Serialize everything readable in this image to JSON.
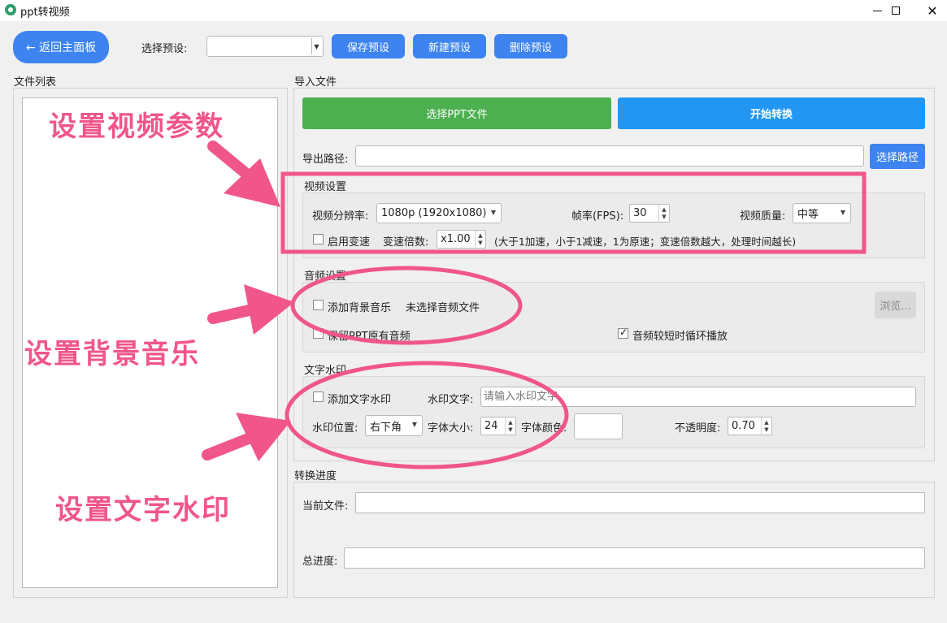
{
  "window": {
    "title": "ppt转视频"
  },
  "toolbar": {
    "back_label": "← 返回主面板",
    "preset_label": "选择预设:",
    "preset_value": "",
    "save_label": "保存预设",
    "new_label": "新建预设",
    "delete_label": "删除预设"
  },
  "file_list": {
    "title": "文件列表"
  },
  "import": {
    "title": "导入文件",
    "select_ppt_label": "选择PPT文件",
    "start_label": "开始转换",
    "export_path_label": "导出路径:",
    "export_path_value": "",
    "choose_path_label": "选择路径"
  },
  "video_settings": {
    "title": "视频设置",
    "resolution_label": "视频分辨率:",
    "resolution_value": "1080p (1920x1080)",
    "fps_label": "帧率(FPS):",
    "fps_value": "30",
    "quality_label": "视频质量:",
    "quality_value": "中等",
    "speed_enable_label": "启用变速",
    "speed_enabled": false,
    "speed_ratio_label": "变速倍数:",
    "speed_ratio_value": "x1.00",
    "speed_hint": "(大于1加速，小于1减速，1为原速；变速倍数越大，处理时间越长)"
  },
  "audio_settings": {
    "title": "音频设置",
    "add_bgm_label": "添加背景音乐",
    "add_bgm_checked": false,
    "no_audio_text": "未选择音频文件",
    "browse_label": "浏览...",
    "keep_original_label": "保留PPT原有音频",
    "keep_original_checked": false,
    "loop_label": "音频较短时循环播放",
    "loop_checked": true
  },
  "watermark": {
    "title": "文字水印",
    "add_label": "添加文字水印",
    "add_checked": false,
    "text_label": "水印文字:",
    "text_placeholder": "请输入水印文字",
    "position_label": "水印位置:",
    "position_value": "右下角",
    "font_size_label": "字体大小:",
    "font_size_value": "24",
    "font_color_label": "字体颜色:",
    "opacity_label": "不透明度:",
    "opacity_value": "0.70"
  },
  "progress": {
    "title": "转换进度",
    "current_file_label": "当前文件:",
    "total_label": "总进度:"
  },
  "annotations": {
    "video_params": "设置视频参数",
    "bgm": "设置背景音乐",
    "watermark": "设置文字水印",
    "color": "#f0568a"
  },
  "colors": {
    "accent_blue": "#3d84f0",
    "green": "#4caf50",
    "start_blue": "#2196f3"
  }
}
